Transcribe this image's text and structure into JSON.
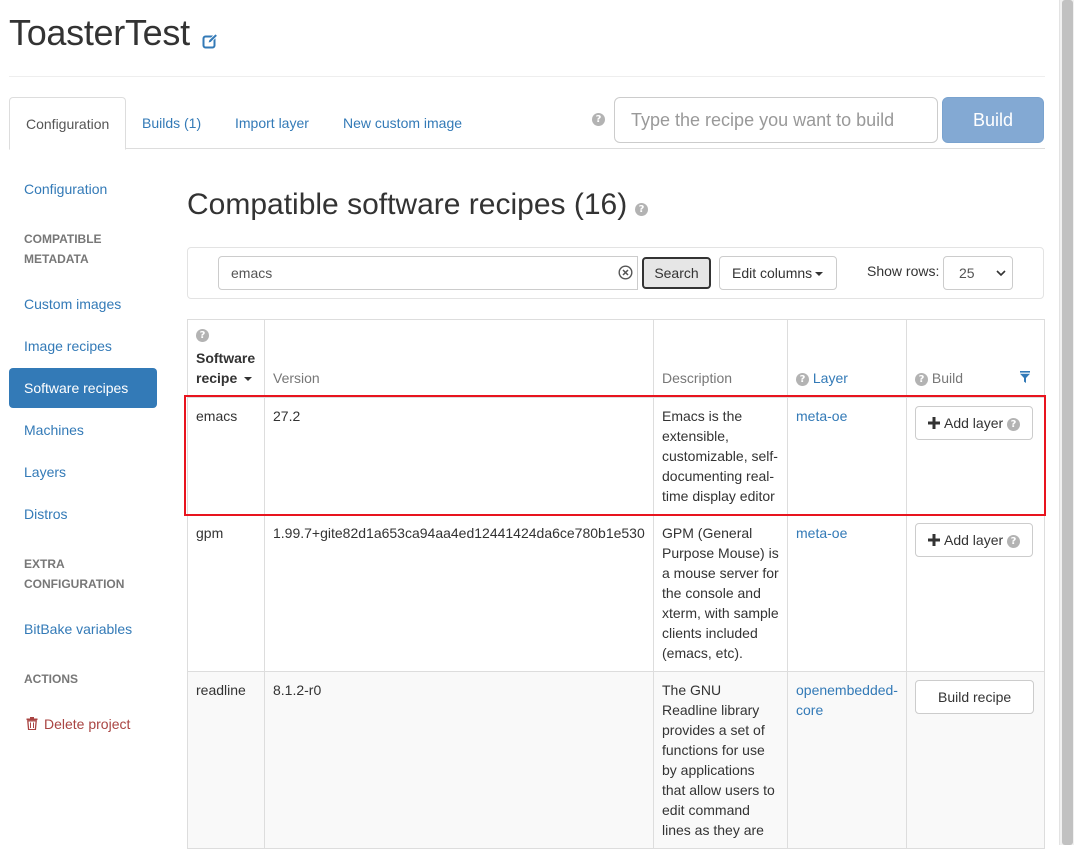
{
  "project": {
    "title": "ToasterTest"
  },
  "tabs": {
    "configuration": "Configuration",
    "builds": "Builds (1)",
    "import_layer": "Import layer",
    "new_custom_image": "New custom image"
  },
  "build_bar": {
    "placeholder": "Type the recipe you want to build",
    "button": "Build"
  },
  "sidebar": {
    "configuration": "Configuration",
    "compatible_metadata_line1": "COMPATIBLE",
    "compatible_metadata_line2": "METADATA",
    "custom_images": "Custom images",
    "image_recipes": "Image recipes",
    "software_recipes": "Software recipes",
    "machines": "Machines",
    "layers": "Layers",
    "distros": "Distros",
    "extra_configuration_line1": "EXTRA",
    "extra_configuration_line2": "CONFIGURATION",
    "bitbake_variables": "BitBake variables",
    "actions": "ACTIONS",
    "delete_project": "Delete project"
  },
  "main": {
    "title": "Compatible software recipes (16)",
    "search_value": "emacs",
    "search_button": "Search",
    "edit_columns": "Edit columns",
    "show_rows_label": "Show rows:",
    "show_rows_value": "25"
  },
  "table": {
    "headers": {
      "recipe_line1": "Software",
      "recipe_line2": "recipe",
      "version": "Version",
      "description": "Description",
      "layer": "Layer",
      "build": "Build"
    },
    "rows": [
      {
        "recipe": "emacs",
        "version": "27.2",
        "description": "Emacs is the extensible, customizable, self-documenting real-time display editor",
        "layer": "meta-oe",
        "action": "Add layer"
      },
      {
        "recipe": "gpm",
        "version": "1.99.7+gite82d1a653ca94aa4ed12441424da6ce780b1e530",
        "description": "GPM (General Purpose Mouse) is a mouse server for the console and xterm, with sample clients included (emacs, etc).",
        "layer": "meta-oe",
        "action": "Add layer"
      },
      {
        "recipe": "readline",
        "version": "8.1.2-r0",
        "description": "The GNU Readline library provides a set of functions for use by applications that allow users to edit command lines as they are",
        "layer": "openembedded-core",
        "action": "Build recipe"
      }
    ]
  },
  "colors": {
    "link": "#337ab7",
    "active_nav": "#337ab7",
    "build_button": "#83a9d3",
    "danger": "#a94442",
    "highlight": "#e8141e"
  },
  "icons": [
    "edit-icon",
    "help-icon",
    "clear-search-icon",
    "caret-down-icon",
    "filter-icon",
    "plus-icon",
    "trash-icon"
  ]
}
